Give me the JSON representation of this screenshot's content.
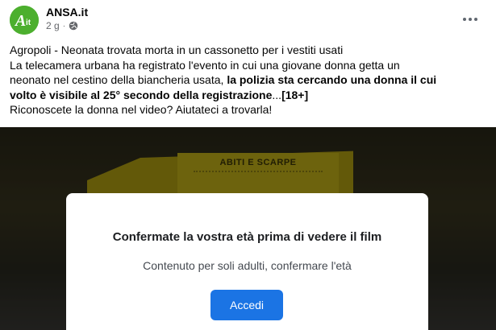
{
  "post": {
    "page_name": "ANSA.it",
    "timestamp": "2 g",
    "avatar_text": "A it",
    "text": {
      "line1": "Agropoli - Neonata trovata morta in un cassonetto per i vestiti usati",
      "line2": "La telecamera urbana ha registrato l'evento in cui una giovane donna getta un",
      "line3_normal": "neonato nel cestino della biancheria usata, ",
      "line3_bold": "la polizia sta cercando una donna il cui",
      "line4_bold": "volto è visibile al 25° secondo della registrazione",
      "line4_ellipsis": "...",
      "line4_tag": "[18+]",
      "line5": "Riconoscete la donna nel video? Aiutateci a trovarla!"
    }
  },
  "media": {
    "bin_label": "ABITI E SCARPE"
  },
  "age_gate": {
    "title": "Confermate la vostra età prima di vedere il film",
    "body": "Contenuto per soli adulti, confermare l'età",
    "button_label": "Accedi"
  },
  "colors": {
    "brand_green": "#4caf2e",
    "button_blue": "#1b74e4",
    "bin_yellow": "#b4a212"
  },
  "icons": {
    "privacy": "globe-icon",
    "menu": "more-options-icon"
  }
}
